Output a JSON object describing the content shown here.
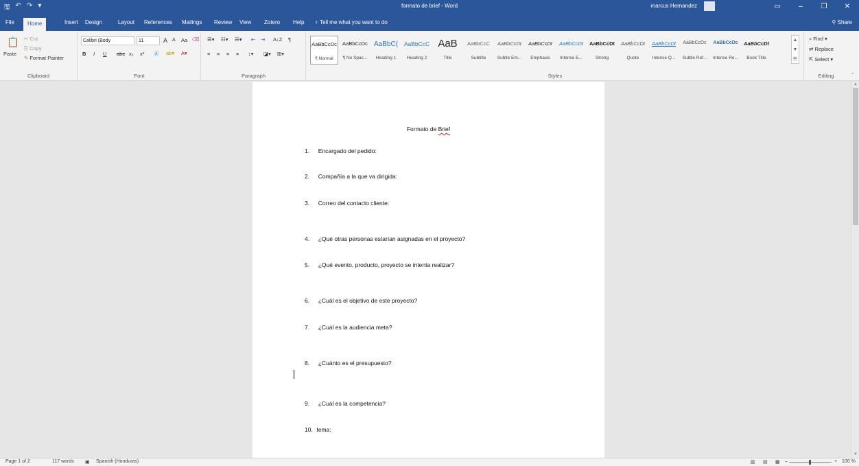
{
  "titlebar": {
    "document_title": "formato de brief - Word",
    "user_name": "marcus Hernandez",
    "quick_access": [
      "save-icon",
      "undo-icon",
      "redo-icon",
      "customize-icon"
    ],
    "window_buttons": [
      "ribbon-display-icon",
      "minimize-icon",
      "restore-icon",
      "close-icon"
    ]
  },
  "tabs": [
    {
      "label": "File",
      "active": false
    },
    {
      "label": "Home",
      "active": true
    },
    {
      "label": "Insert",
      "active": false
    },
    {
      "label": "Design",
      "active": false
    },
    {
      "label": "Layout",
      "active": false
    },
    {
      "label": "References",
      "active": false
    },
    {
      "label": "Mailings",
      "active": false
    },
    {
      "label": "Review",
      "active": false
    },
    {
      "label": "View",
      "active": false
    },
    {
      "label": "Zotero",
      "active": false
    },
    {
      "label": "Help",
      "active": false
    }
  ],
  "tell_me": "Tell me what you want to do",
  "share_label": "Share",
  "clipboard": {
    "paste": "Paste",
    "cut": "Cut",
    "copy": "Copy",
    "format_painter": "Format Painter",
    "label": "Clipboard"
  },
  "font": {
    "font_name": "Calibri (Body",
    "font_size": "11",
    "label": "Font",
    "bold": "B",
    "italic": "I",
    "underline": "U",
    "strikethrough": "abc",
    "subscript": "x₂",
    "superscript": "x²",
    "grow": "A",
    "shrink": "A",
    "change_case": "Aa"
  },
  "paragraph": {
    "label": "Paragraph",
    "sort": "A↓Z",
    "marks": "¶"
  },
  "styles": {
    "label": "Styles",
    "items": [
      {
        "sample": "AaBbCcDc",
        "name": "¶ Normal"
      },
      {
        "sample": "AaBbCcDc",
        "name": "¶ No Spac..."
      },
      {
        "sample": "AaBbC(",
        "name": "Heading 1"
      },
      {
        "sample": "AaBbCcC",
        "name": "Heading 2"
      },
      {
        "sample": "AaB",
        "name": "Title"
      },
      {
        "sample": "AaBbCcC",
        "name": "Subtitle"
      },
      {
        "sample": "AaBbCcDt",
        "name": "Subtle Em..."
      },
      {
        "sample": "AaBbCcDt",
        "name": "Emphasis"
      },
      {
        "sample": "AaBbCcDt",
        "name": "Intense E..."
      },
      {
        "sample": "AaBbCcDt",
        "name": "Strong"
      },
      {
        "sample": "AaBbCcDt",
        "name": "Quote"
      },
      {
        "sample": "AaBbCcDt",
        "name": "Intense Q..."
      },
      {
        "sample": "AaBbCcDc",
        "name": "Subtle Ref..."
      },
      {
        "sample": "AaBbCcDc",
        "name": "Intense Re..."
      },
      {
        "sample": "AaBbCcDt",
        "name": "Book Title"
      }
    ]
  },
  "editing": {
    "label": "Editing",
    "find": "Find",
    "replace": "Replace",
    "select": "Select"
  },
  "document": {
    "title_prefix": "Formato de",
    "title_word": "Brief",
    "questions": [
      {
        "num": "1.",
        "text": "Encargado del pedido:"
      },
      {
        "num": "2.",
        "text": "Compañía a la que va dirigida:"
      },
      {
        "num": "3.",
        "text": "Correo del contacto cliente:"
      },
      {
        "num": "4.",
        "text": "¿Qué otras personas estarían asignadas en el proyecto?"
      },
      {
        "num": "5.",
        "text": "¿Qué evento, producto, proyecto se intenta realizar?"
      },
      {
        "num": "6.",
        "text": "¿Cuál es el objetivo de este proyecto?"
      },
      {
        "num": "7.",
        "text": "¿Cuál es la audiencia meta?"
      },
      {
        "num": "8.",
        "text": "¿Cuánto es el presupuesto?"
      },
      {
        "num": "9.",
        "text": "¿Cuál es la competencia?"
      },
      {
        "num": "10.",
        "text": "tema:"
      }
    ]
  },
  "status": {
    "page": "Page 1 of 2",
    "words": "117 words",
    "language": "Spanish (Honduras)",
    "zoom": "100 %"
  }
}
